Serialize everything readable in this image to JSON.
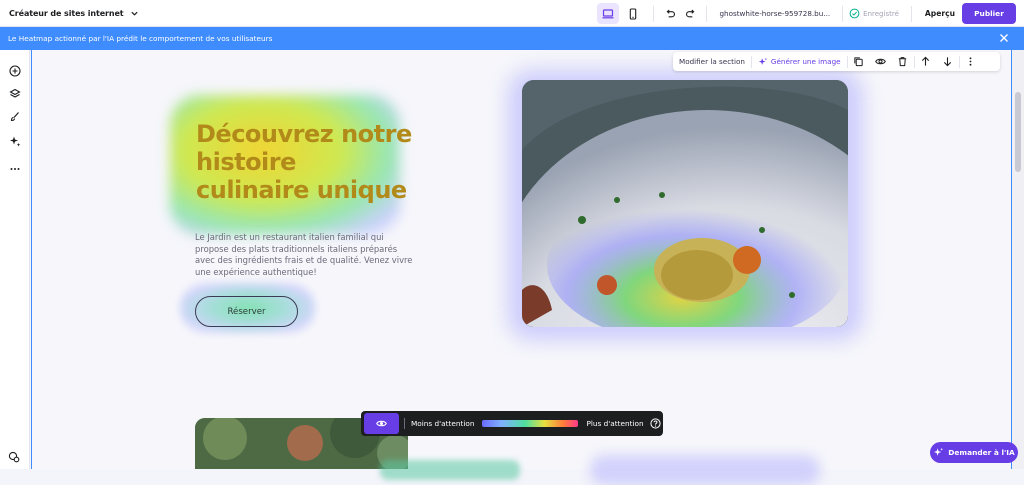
{
  "topbar": {
    "brand_label": "Créateur de sites internet",
    "domain": "ghostwhite-horse-959728.bu...",
    "saved_label": "Enregistré",
    "preview_label": "Aperçu",
    "publish_label": "Publier"
  },
  "banner": {
    "text": "Le Heatmap actionné par l'IA prédit le comportement de vos utilisateurs"
  },
  "section_toolbar": {
    "edit_label": "Modifier la section",
    "generate_label": "Générer une image"
  },
  "hero": {
    "title": "Découvrez notre histoire culinaire unique",
    "description": "Le Jardin est un restaurant italien familial qui propose des plats traditionnels italiens préparés avec des ingrédients frais et de qualité. Venez vivre une expérience authentique!",
    "cta_label": "Réserver"
  },
  "heatmap_bar": {
    "less_label": "Moins d'attention",
    "more_label": "Plus d'attention"
  },
  "ai_button": {
    "label": "Demander à l'IA"
  },
  "colors": {
    "brand": "#673de6",
    "banner": "#3f8cff",
    "bar": "#1d1e20"
  }
}
